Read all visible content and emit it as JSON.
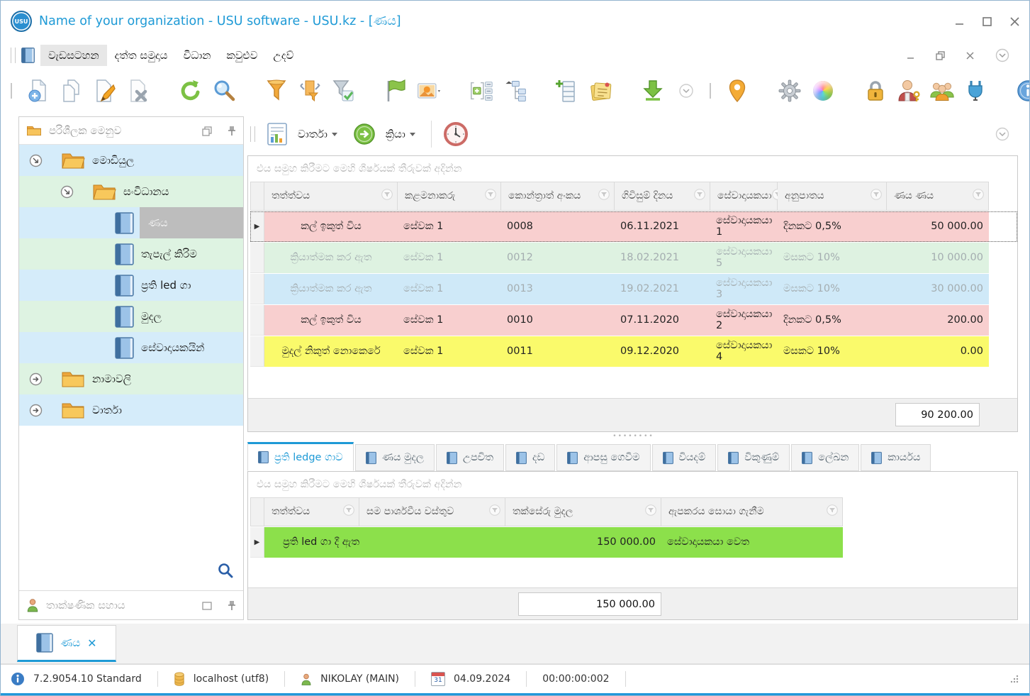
{
  "window": {
    "title": "Name of your organization - USU software - USU.kz - [ණය]",
    "logo_text": "USU"
  },
  "menu": {
    "items": [
      "වැඩසටහන",
      "දත්ත සමුදාය",
      "විධාන",
      "කවුළුව",
      "උදව්"
    ]
  },
  "toolbar": {
    "icons": [
      "add-record-icon",
      "copy-record-icon",
      "edit-record-icon",
      "delete-record-icon",
      "refresh-icon",
      "search-icon",
      "filter-icon",
      "filter-column-icon",
      "filter-apply-icon",
      "flag-icon",
      "image-icon",
      "expand-rows-icon",
      "tree-structure-icon",
      "add-column-icon",
      "notes-icon",
      "export-icon",
      "chevron-icon",
      "location-pin-icon",
      "settings-gear-icon",
      "appearance-sphere-icon",
      "lock-icon",
      "user-permissions-icon",
      "users-group-icon",
      "plugin-icon",
      "info-icon"
    ]
  },
  "sidebar": {
    "header": "පරිශීලක මෙනුව",
    "tree": [
      {
        "label": "මොඩියුල"
      },
      {
        "label": "සංවිධානය"
      },
      {
        "label": "ණය"
      },
      {
        "label": "තැපැල් කිරිම"
      },
      {
        "label": "ප්‍රති led ගා"
      },
      {
        "label": "මුදල"
      },
      {
        "label": "සේවාදායකයින්"
      },
      {
        "label": "නාමාවලි"
      },
      {
        "label": "වාර්තා"
      }
    ],
    "support_panel": "තාක්ෂණික සහාය"
  },
  "main": {
    "reports_button": "වාර්තා",
    "actions_button": "ක්‍රියා",
    "group_hint": "එය සමුහ කිරීමට මෙහි ශීර්ෂයක් තීරුවක් අදින්න",
    "table": {
      "columns": [
        "තත්ත්වය",
        "කළමනාකරු",
        "කොන්ත්‍රාත් අංකය",
        "ගිවිසුම් දිනය",
        "සේවාදායකයා",
        "අනුපාතය",
        "ණය ණය"
      ],
      "rows": [
        {
          "status": "කල් ඉකුත් විය",
          "manager": "සේවක 1",
          "contract": "0008",
          "date": "06.11.2021",
          "client": "සේවාදායකයා 1",
          "rate": "දිනකට 0,5%",
          "amount": "50 000.00"
        },
        {
          "status": "ක්‍රියාත්මක කර ඇත",
          "manager": "සේවක 1",
          "contract": "0012",
          "date": "18.02.2021",
          "client": "සේවාදායකයා 5",
          "rate": "මසකට 10%",
          "amount": "10 000.00"
        },
        {
          "status": "ක්‍රියාත්මක කර ඇත",
          "manager": "සේවක 1",
          "contract": "0013",
          "date": "19.02.2021",
          "client": "සේවාදායකයා 3",
          "rate": "මසකට 10%",
          "amount": "30 000.00"
        },
        {
          "status": "කල් ඉකුත් විය",
          "manager": "සේවක 1",
          "contract": "0010",
          "date": "07.11.2020",
          "client": "සේවාදායකයා 2",
          "rate": "දිනකට 0,5%",
          "amount": "200.00"
        },
        {
          "status": "මුදල් නිකුත් නොකෙරේ",
          "manager": "සේවක 1",
          "contract": "0011",
          "date": "09.12.2020",
          "client": "සේවාදායකයා 4",
          "rate": "මසකට 10%",
          "amount": "0.00"
        }
      ],
      "total": "90 200.00"
    },
    "tabs": [
      "ප්‍රති ledge ගාව",
      "ණය මුදල",
      "උපචිත",
      "දඩ",
      "ආපසු ගෙවීම",
      "වියදම්",
      "විකුණුම්",
      "ලේඛන",
      "කාර්යය"
    ],
    "detail": {
      "group_hint": "එය සමුහ කිරීමට මෙහි ශීර්ෂයක් තීරුවක් අදින්න",
      "columns": [
        "තත්ත්වය",
        "සම පාර්ශවීය වස්තුව",
        "තක්සේරු මුදල",
        "ඇපකරය සොයා ගැනීම"
      ],
      "rows": [
        {
          "status": "ප්‍රති led ගා දී ඇත",
          "object": "",
          "amount": "150 000.00",
          "note": "සේවාදායකයා වෙත"
        }
      ],
      "total": "150 000.00"
    }
  },
  "doc_tab": {
    "label": "ණය"
  },
  "status_bar": {
    "version": "7.2.9054.10 Standard",
    "database": "localhost (utf8)",
    "user": "NIKOLAY (MAIN)",
    "calendar_day": "31",
    "date": "04.09.2024",
    "time": "00:00:00:002"
  },
  "colors": {
    "accent_blue": "#1e9ad6",
    "row_pink": "#f8cfcf",
    "row_green": "#def2e1",
    "row_blue": "#cfe9f8",
    "row_yellow": "#fafa6b",
    "row_active_green": "#8ce04b",
    "tree_blue": "#d5ecfa",
    "tree_green": "#def3e2",
    "selected_gray": "#bdbdbd"
  }
}
